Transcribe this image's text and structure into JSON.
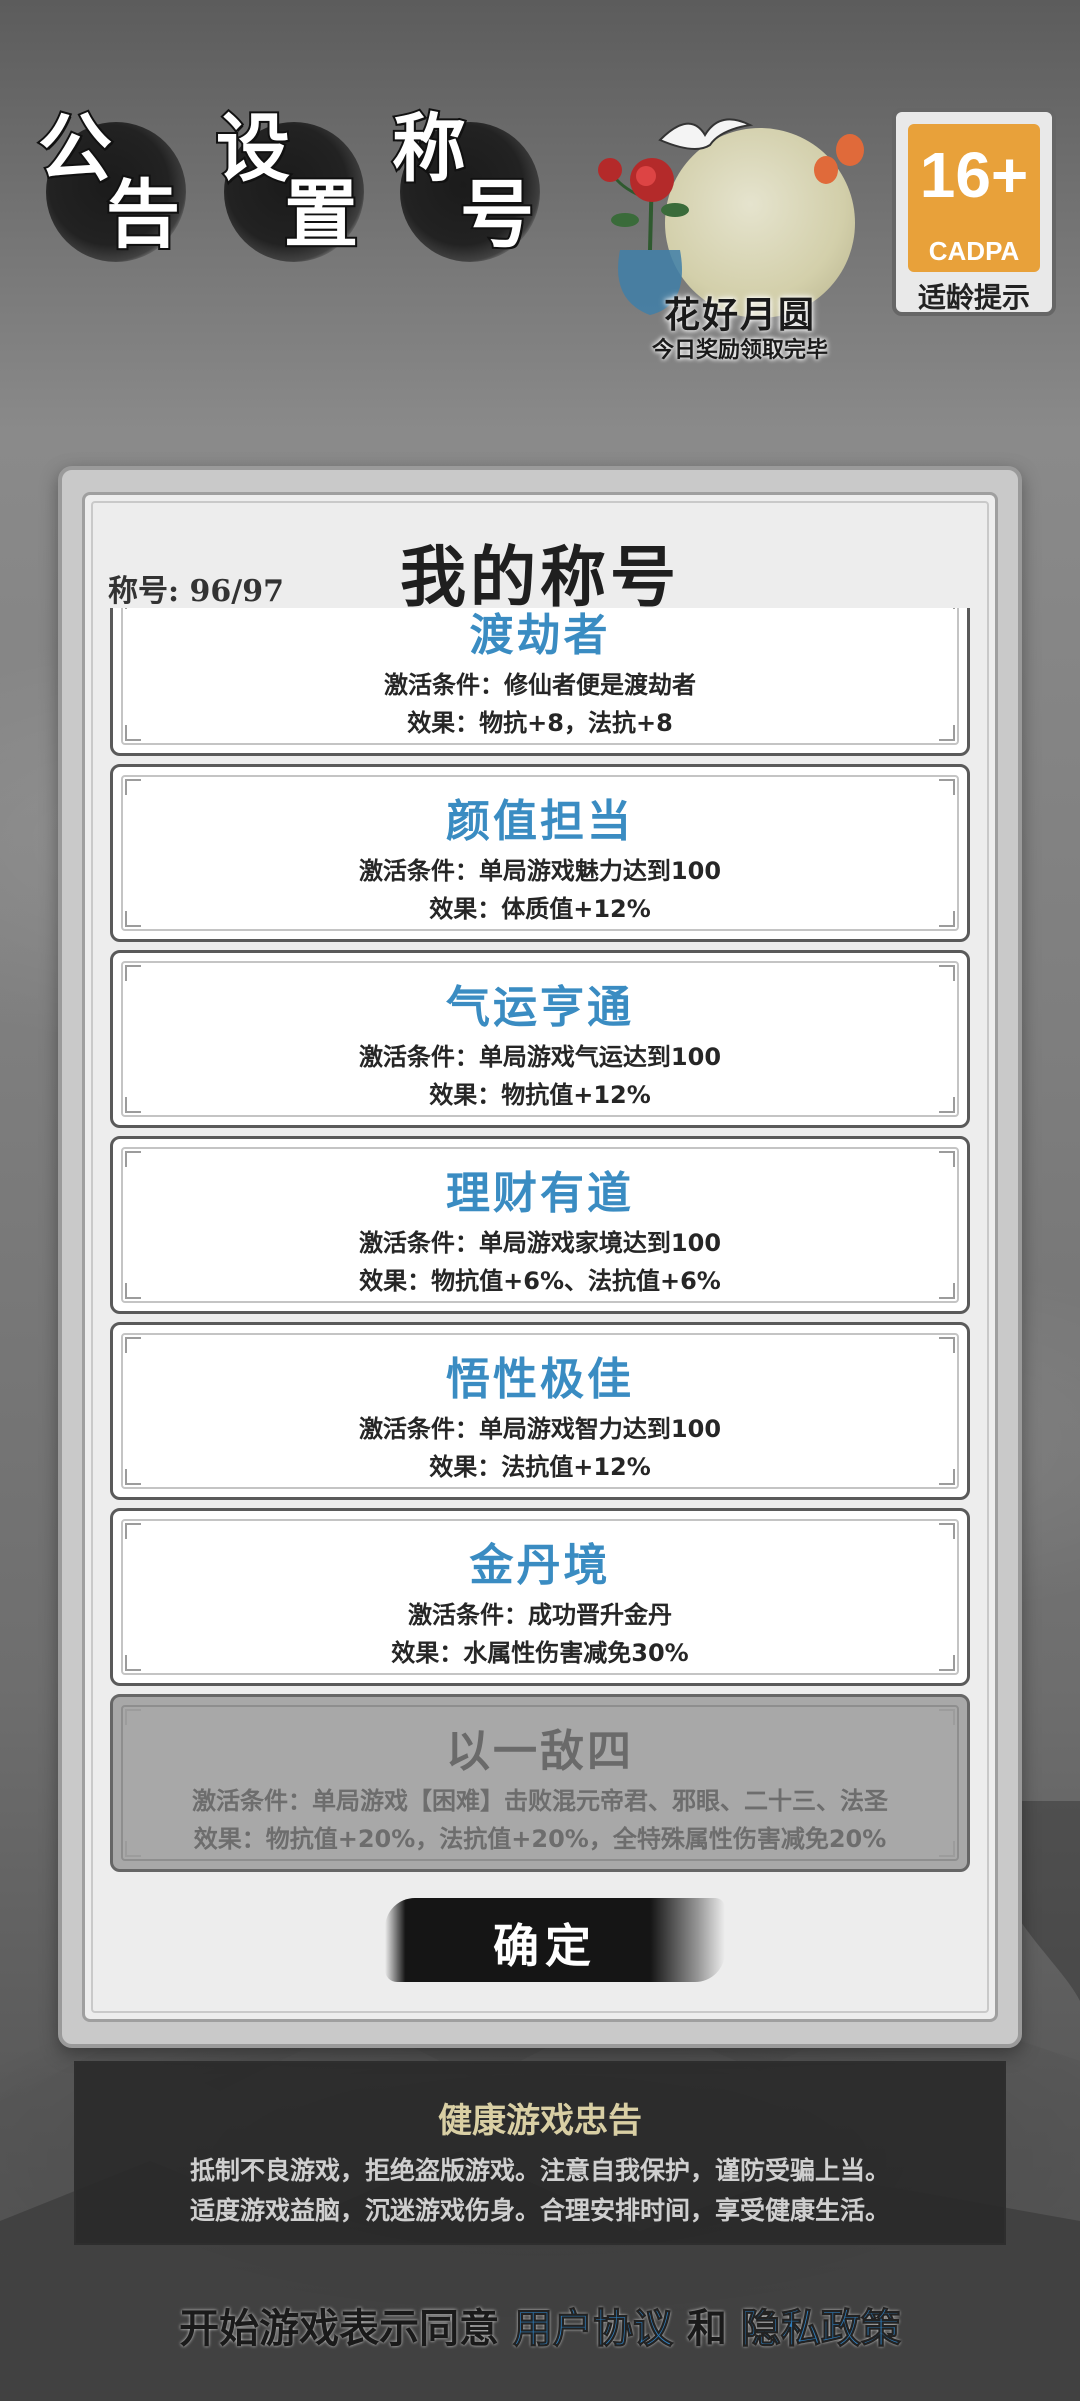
{
  "top_menu": {
    "announcement": [
      "公",
      "告"
    ],
    "settings": [
      "设",
      "置"
    ],
    "titles": [
      "称",
      "号"
    ]
  },
  "event": {
    "title": "花好月圆",
    "subtitle": "今日奖励领取完毕"
  },
  "age_rating": {
    "number": "16+",
    "org": "CADPA",
    "label": "适龄提示",
    "color": "#e8a13a"
  },
  "dialog": {
    "count": "称号: 96/97",
    "title": "我的称号",
    "confirm_label": "确定",
    "cards": [
      {
        "name": "渡劫者",
        "condition": "激活条件：修仙者便是渡劫者",
        "effect": "效果：物抗+8，法抗+8",
        "locked": false
      },
      {
        "name": "颜值担当",
        "condition": "激活条件：单局游戏魅力达到100",
        "effect": "效果：体质值+12%",
        "locked": false
      },
      {
        "name": "气运亨通",
        "condition": "激活条件：单局游戏气运达到100",
        "effect": "效果：物抗值+12%",
        "locked": false
      },
      {
        "name": "理财有道",
        "condition": "激活条件：单局游戏家境达到100",
        "effect": "效果：物抗值+6%、法抗值+6%",
        "locked": false
      },
      {
        "name": "悟性极佳",
        "condition": "激活条件：单局游戏智力达到100",
        "effect": "效果：法抗值+12%",
        "locked": false
      },
      {
        "name": "金丹境",
        "condition": "激活条件：成功晋升金丹",
        "effect": "效果：水属性伤害减免30%",
        "locked": false
      },
      {
        "name": "以一敌四",
        "condition": "激活条件：单局游戏【困难】击败混元帝君、邪眼、二十三、法圣",
        "effect": "效果：物抗值+20%，法抗值+20%，全特殊属性伤害减免20%",
        "locked": true
      }
    ]
  },
  "health": {
    "title": "健康游戏忠告",
    "line1": "抵制不良游戏，拒绝盗版游戏。注意自我保护，谨防受骗上当。",
    "line2": "适度游戏益脑，沉迷游戏伤身。合理安排时间，享受健康生活。"
  },
  "agreement": {
    "prefix": "开始游戏表示同意",
    "user_agreement": "用户协议",
    "and": "和",
    "privacy_policy": "隐私政策"
  }
}
